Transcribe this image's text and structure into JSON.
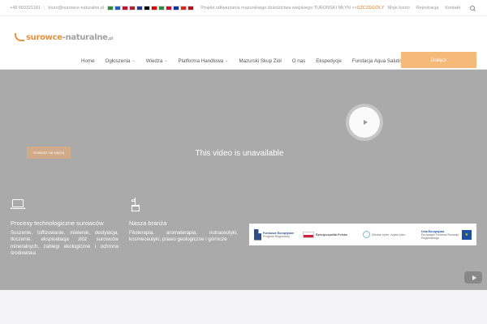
{
  "topbar": {
    "phone": "+48 603321181",
    "email": "biuro@surowce-naturalne.pl",
    "flags": [
      "#2e8b3e",
      "#1e5fbf",
      "#c8102e",
      "#b22234",
      "#2b3a8c",
      "#000000",
      "#dd0000",
      "#2e8b3e",
      "#c8102e",
      "#0033a0",
      "#d52b1e",
      "#aa151b"
    ],
    "promo_text": "Projekt odtwarzania mazurskiego dziedzictwa wiejskiego TURONSKI MŁYN >>",
    "promo_link": "SZCZEGÓŁY",
    "links": [
      "Moje konto",
      "Rejestracja",
      "Kontakt"
    ],
    "search_icon": "search-icon"
  },
  "logo": {
    "part1": "surowce",
    "part2": "-naturalne",
    "suffix": ".pl"
  },
  "nav": {
    "items": [
      {
        "label": "Home",
        "dropdown": false
      },
      {
        "label": "Ogłoszenia",
        "dropdown": true
      },
      {
        "label": "Wiedza",
        "dropdown": true
      },
      {
        "label": "Platforma Handlowa",
        "dropdown": true
      },
      {
        "label": "Mazurski Skup Ziół",
        "dropdown": false
      },
      {
        "label": "O nas",
        "dropdown": false
      },
      {
        "label": "Ekspedycje",
        "dropdown": false
      },
      {
        "label": "Fundacja Aqua Salutis",
        "dropdown": false
      }
    ],
    "donate_label": "Dołącz"
  },
  "video": {
    "message": "This video is unavailable",
    "more_label": "Dowiedz się więcej"
  },
  "features": [
    {
      "icon": "laptop-icon",
      "title": "Procesy technologiczne surowców",
      "text": "Suszenie, toffizowanie, mielenie, destylacja, tłoczenie, eksploatacja złóż surowców mineralnych, zabiegi ekologiczne i ochrona środowiska"
    },
    {
      "icon": "plant-icon",
      "title": "Nasza branża",
      "text": "Fitoterapia, aromaterapia, nutraceutyki, kosmeceutyki, prawo geologiczne i górnicze"
    }
  ],
  "eu_banner": {
    "fund": "Fundusze Europejskie",
    "fund_sub": "Program Regionalny",
    "region": "Rzeczpospolita Polska",
    "mazury": "Zdrowe życie, czyste jutro",
    "union": "Unia Europejska",
    "union_sub": "Europejski Fundusz Rozwoju Regionalnego"
  },
  "colors": {
    "accent": "#e8913a",
    "donate_bg": "#f5b97a",
    "video_bg": "#a9aaa9"
  }
}
